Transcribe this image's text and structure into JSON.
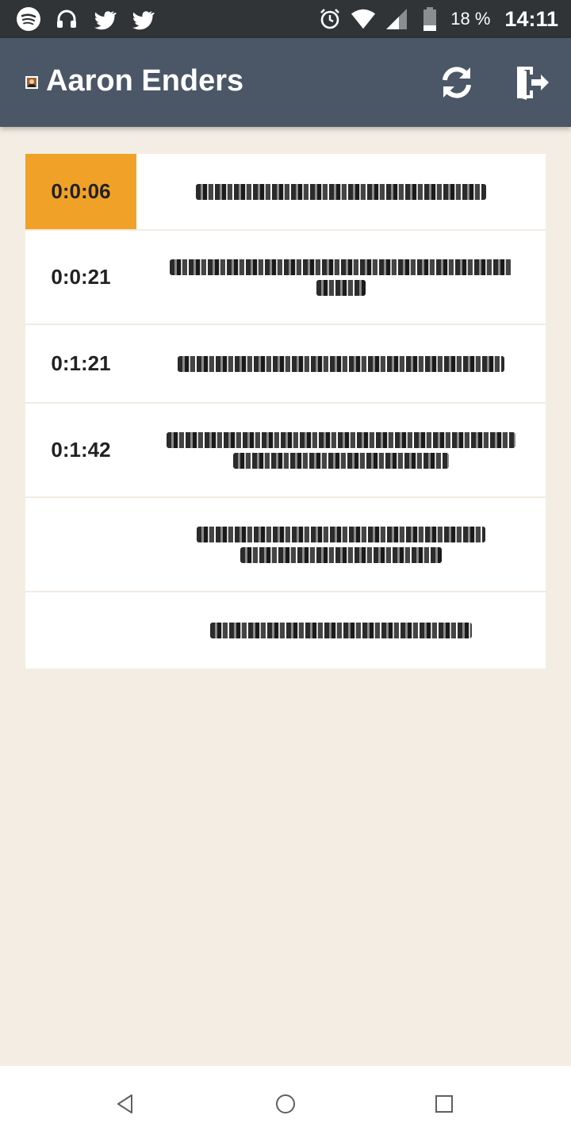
{
  "statusbar": {
    "left_icons": [
      "spotify-icon",
      "headset-icon",
      "twitter-icon",
      "twitter-icon"
    ],
    "right_icons": [
      "alarm-icon",
      "wifi-icon",
      "signal-icon",
      "battery-icon"
    ],
    "battery_text": "18 %",
    "time": "14:11"
  },
  "appbar": {
    "title": "Aaron Enders",
    "avatar_icon": "user-avatar",
    "refresh_icon": "refresh-icon",
    "exit_icon": "exit-door-icon",
    "background_color": "#4b5766"
  },
  "rows": [
    {
      "time": "0:0:06",
      "active": true
    },
    {
      "time": "0:0:21",
      "active": false
    },
    {
      "time": "0:1:21",
      "active": false
    },
    {
      "time": "0:1:42",
      "active": false
    },
    {
      "time": "",
      "active": false
    },
    {
      "time": "",
      "active": false
    }
  ],
  "colors": {
    "accent": "#f0a228",
    "page_background": "#f4ede4",
    "card_background": "#ffffff"
  },
  "navbar": {
    "icons": [
      "back-icon",
      "home-icon",
      "recent-apps-icon"
    ]
  }
}
